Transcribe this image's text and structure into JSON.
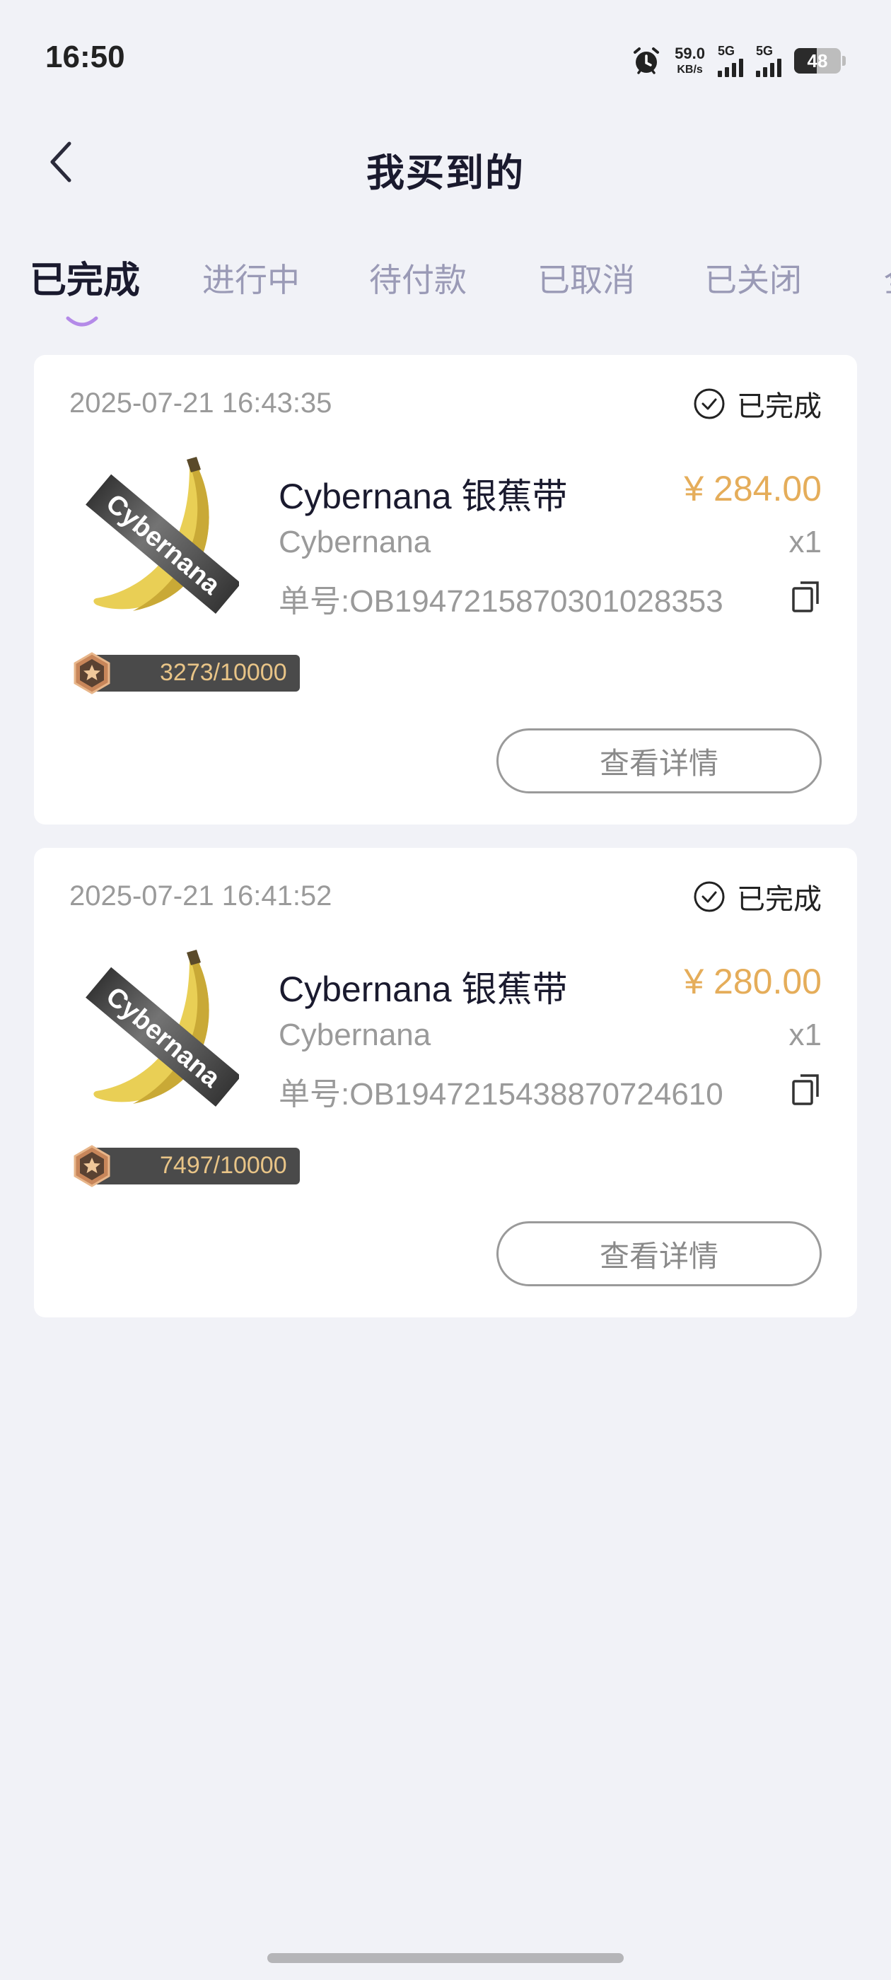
{
  "status_bar": {
    "time": "16:50",
    "net_speed_value": "59.0",
    "net_speed_unit": "KB/s",
    "signal_1_label": "5G",
    "signal_2_label": "5G",
    "battery_level": "48"
  },
  "header": {
    "title": "我买到的",
    "back_icon": "chevron-left-icon"
  },
  "tabs": [
    {
      "label": "已完成",
      "active": true
    },
    {
      "label": "进行中"
    },
    {
      "label": "待付款"
    },
    {
      "label": "已取消"
    },
    {
      "label": "已关闭"
    }
  ],
  "accent_color": "#e5ad5a",
  "orders": [
    {
      "time": "2025-07-21 16:43:35",
      "status": "已完成",
      "product_name": "Cybernana 银蕉带",
      "price": "¥ 284.00",
      "brand": "Cybernana",
      "quantity": "x1",
      "order_no": "单号:OB1947215870301028353",
      "edition": "3273/10000",
      "detail_label": "查看详情"
    },
    {
      "time": "2025-07-21 16:41:52",
      "status": "已完成",
      "product_name": "Cybernana 银蕉带",
      "price": "¥ 280.00",
      "brand": "Cybernana",
      "quantity": "x1",
      "order_no": "单号:OB1947215438870724610",
      "edition": "7497/10000",
      "detail_label": "查看详情"
    }
  ],
  "product_image_text": "Cybernana"
}
